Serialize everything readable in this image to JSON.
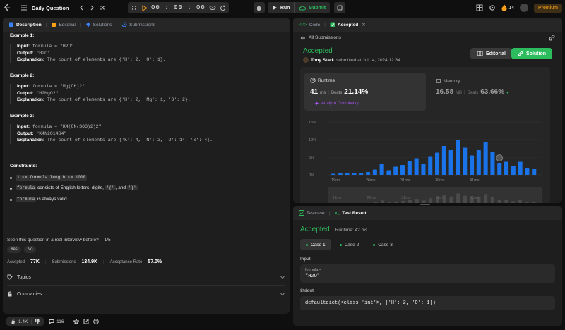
{
  "topbar": {
    "title": "Daily Question",
    "timer": "00 : 00 : 00",
    "run_label": "Run",
    "submit_label": "Submit",
    "streak_count": "14",
    "premium_label": "Premium"
  },
  "left": {
    "tabs": [
      "Description",
      "Editorial",
      "Solutions",
      "Submissions"
    ],
    "examples": [
      {
        "header": "Example 1:",
        "input": "formula = \"H2O\"",
        "output": "\"H2O\"",
        "explanation": "The count of elements are {'H': 2, 'O': 1}."
      },
      {
        "header": "Example 2:",
        "input": "formula = \"Mg(OH)2\"",
        "output": "\"H2MgO2\"",
        "explanation": "The count of elements are {'H': 2, 'Mg': 1, 'O': 2}."
      },
      {
        "header": "Example 3:",
        "input": "formula = \"K4(ON(SO3)2)2\"",
        "output": "\"K4N2O14S4\"",
        "explanation": "The count of elements are {'K': 4, 'N': 2, 'O': 14, 'S': 4}."
      }
    ],
    "labels": {
      "input": "Input:",
      "output": "Output:",
      "explanation": "Explanation:"
    },
    "constraints_title": "Constraints:",
    "constraints": {
      "c1_code": "1 <= formula.length <= 1000",
      "c2_code": "formula",
      "c2_text": "consists of English letters, digits,",
      "c2_open": "'('",
      "c2_and": ", and",
      "c2_close": "')'",
      "c2_end": ".",
      "c3_code": "formula",
      "c3_text": "is always valid."
    },
    "interview": {
      "question": "Seen this question in a real interview before?",
      "count": "1/5",
      "yes": "Yes",
      "no": "No"
    },
    "stats": {
      "accepted_label": "Accepted",
      "accepted_value": "77K",
      "submissions_label": "Submissions",
      "submissions_value": "134.9K",
      "rate_label": "Acceptance Rate",
      "rate_value": "57.0%"
    },
    "sections": {
      "topics": "Topics",
      "companies": "Companies"
    },
    "bottom": {
      "likes": "1.4K",
      "comments": "116"
    }
  },
  "right_top": {
    "tabs": [
      "Code",
      "Accepted"
    ],
    "all_submissions": "All Submissions",
    "status": "Accepted",
    "user": "Tony Stark",
    "submitted": "submitted at Jul 14, 2024 12:34",
    "editorial_label": "Editorial",
    "solution_label": "Solution",
    "runtime": {
      "label": "Runtime",
      "value": "41",
      "unit": "ms",
      "beats_label": "Beats",
      "beats_value": "21.14%",
      "analyze": "Analyze Complexity"
    },
    "memory": {
      "label": "Memory",
      "value": "16.58",
      "unit": "MB",
      "beats_label": "Beats",
      "beats_value": "63.66%"
    }
  },
  "chart_data": {
    "type": "bar",
    "y_ticks": [
      "15%",
      "10%",
      "5%",
      "0%"
    ],
    "x_ticks": [
      "19ms",
      "26ms",
      "31ms",
      "36ms",
      "41ms"
    ],
    "ylim": [
      0,
      15
    ],
    "values": [
      0.3,
      0.4,
      0.4,
      0.5,
      0.6,
      0.8,
      1.5,
      3.2,
      1.3,
      2.3,
      2.8,
      3.8,
      4.7,
      3.2,
      5.3,
      6.3,
      8.2,
      7.0,
      10.0,
      7.7,
      5.5,
      7.0,
      9.3,
      6.5,
      3.4,
      3.7,
      2.5,
      3.7,
      2.0,
      1.8
    ],
    "highlight_index": 24,
    "colors": {
      "bar": "#1a73e8"
    }
  },
  "right_bottom": {
    "tabs": [
      "Testcase",
      "Test Result"
    ],
    "status": "Accepted",
    "runtime": "Runtime: 42 ms",
    "cases": [
      "Case 1",
      "Case 2",
      "Case 3"
    ],
    "input_label": "Input",
    "input_var": "formula =",
    "input_value": "\"H2O\"",
    "stdout_label": "Stdout",
    "stdout_value": "defaultdict(<class 'int'>, {'H': 2, 'O': 1})"
  }
}
